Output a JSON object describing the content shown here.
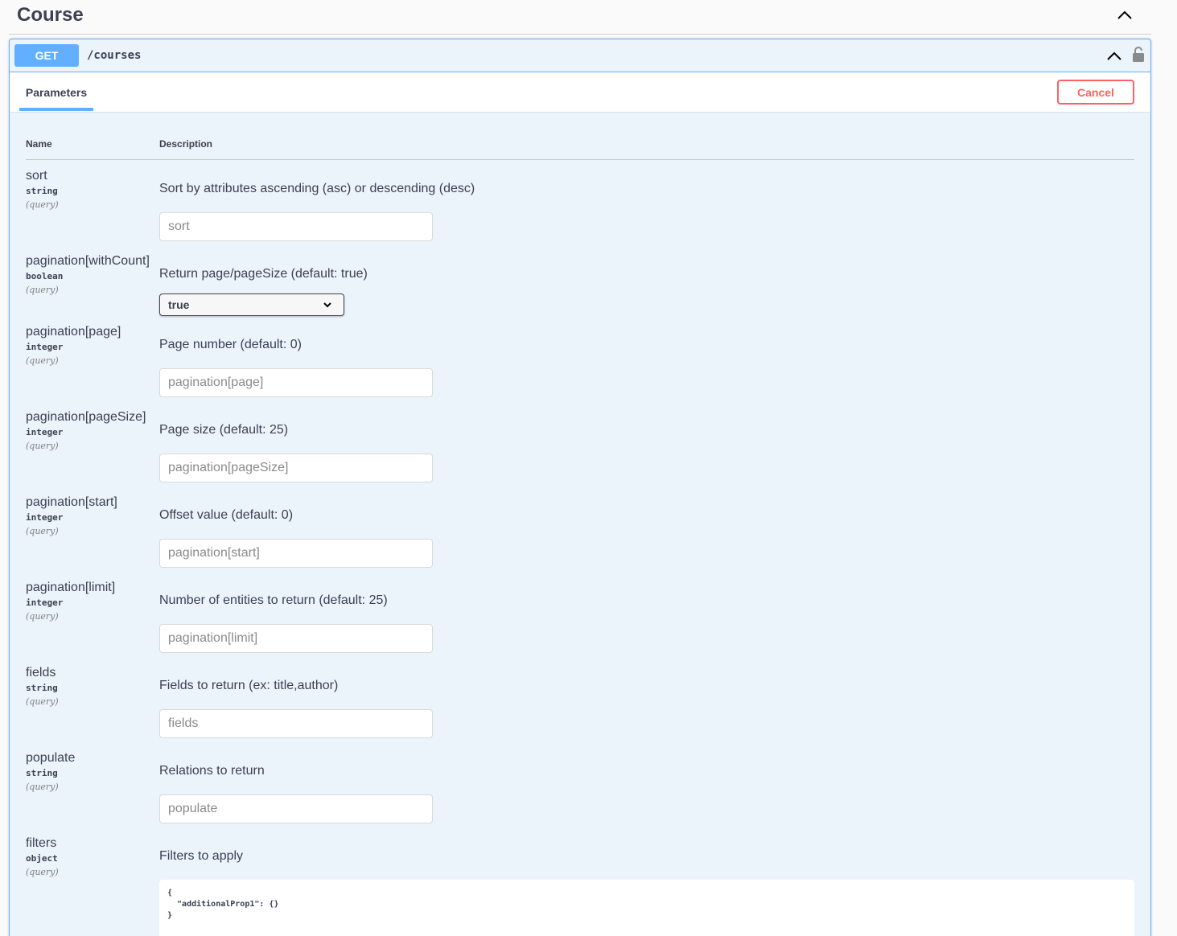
{
  "section": {
    "title": "Course"
  },
  "operation": {
    "method": "GET",
    "path": "/courses",
    "tab_label": "Parameters",
    "cancel_label": "Cancel"
  },
  "columns": {
    "name": "Name",
    "description": "Description"
  },
  "params": [
    {
      "name": "sort",
      "type": "string",
      "in": "(query)",
      "description": "Sort by attributes ascending (asc) or descending (desc)",
      "placeholder": "sort"
    },
    {
      "name": "pagination[withCount]",
      "type": "boolean",
      "in": "(query)",
      "description": "Return page/pageSize (default: true)",
      "selected": "true"
    },
    {
      "name": "pagination[page]",
      "type": "integer",
      "in": "(query)",
      "description": "Page number (default: 0)",
      "placeholder": "pagination[page]"
    },
    {
      "name": "pagination[pageSize]",
      "type": "integer",
      "in": "(query)",
      "description": "Page size (default: 25)",
      "placeholder": "pagination[pageSize]"
    },
    {
      "name": "pagination[start]",
      "type": "integer",
      "in": "(query)",
      "description": "Offset value (default: 0)",
      "placeholder": "pagination[start]"
    },
    {
      "name": "pagination[limit]",
      "type": "integer",
      "in": "(query)",
      "description": "Number of entities to return (default: 25)",
      "placeholder": "pagination[limit]"
    },
    {
      "name": "fields",
      "type": "string",
      "in": "(query)",
      "description": "Fields to return (ex: title,author)",
      "placeholder": "fields"
    },
    {
      "name": "populate",
      "type": "string",
      "in": "(query)",
      "description": "Relations to return",
      "placeholder": "populate"
    },
    {
      "name": "filters",
      "type": "object",
      "in": "(query)",
      "description": "Filters to apply",
      "value": "{\n  \"additionalProp1\": {}\n}"
    }
  ],
  "icons": {
    "collapse": "chevron-up-icon",
    "lock": "lock-icon",
    "dropdown": "chevron-down-icon"
  },
  "colors": {
    "get": "#61affe",
    "cancel": "#ff6060",
    "background": "#ebf3fb"
  }
}
